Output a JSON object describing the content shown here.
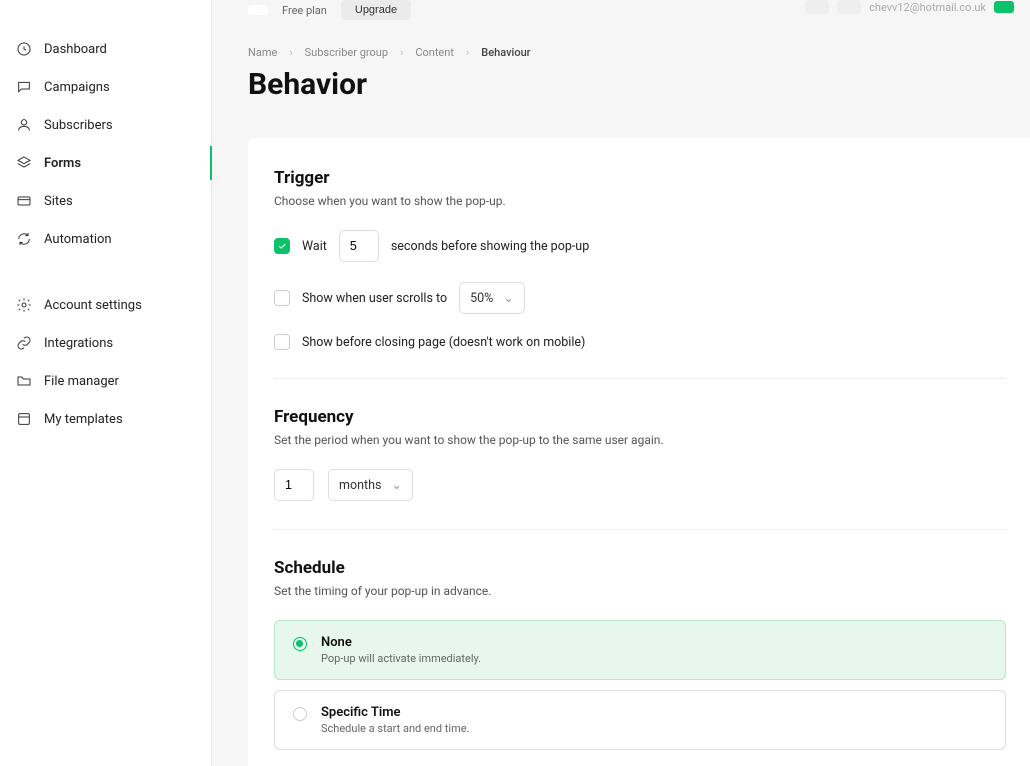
{
  "topbar": {
    "plan_label": "Free plan",
    "upgrade_label": "Upgrade",
    "email": "chevv12@hotmail.co.uk"
  },
  "sidebar": {
    "items": [
      {
        "label": "Dashboard",
        "icon": "clock-icon"
      },
      {
        "label": "Campaigns",
        "icon": "comment-icon"
      },
      {
        "label": "Subscribers",
        "icon": "user-icon"
      },
      {
        "label": "Forms",
        "icon": "layers-icon",
        "active": true
      },
      {
        "label": "Sites",
        "icon": "card-icon"
      },
      {
        "label": "Automation",
        "icon": "refresh-icon"
      }
    ],
    "items2": [
      {
        "label": "Account settings",
        "icon": "gear-icon"
      },
      {
        "label": "Integrations",
        "icon": "link-icon"
      },
      {
        "label": "File manager",
        "icon": "folder-icon"
      },
      {
        "label": "My templates",
        "icon": "template-icon"
      }
    ]
  },
  "breadcrumbs": [
    "Name",
    "Subscriber group",
    "Content",
    "Behaviour"
  ],
  "page_title": "Behavior",
  "trigger": {
    "title": "Trigger",
    "desc": "Choose when you want to show the pop-up.",
    "wait_label": "Wait",
    "wait_value": "5",
    "wait_suffix": "seconds before showing the pop-up",
    "scroll_label": "Show when user scrolls to",
    "scroll_value": "50%",
    "close_label": "Show before closing page (doesn't work on mobile)"
  },
  "frequency": {
    "title": "Frequency",
    "desc": "Set the period when you want to show the pop-up to the same user again.",
    "value": "1",
    "unit": "months"
  },
  "schedule": {
    "title": "Schedule",
    "desc": "Set the timing of your pop-up in advance.",
    "options": [
      {
        "label": "None",
        "sub": "Pop-up will activate immediately.",
        "selected": true
      },
      {
        "label": "Specific Time",
        "sub": "Schedule a start and end time.",
        "selected": false
      }
    ]
  }
}
